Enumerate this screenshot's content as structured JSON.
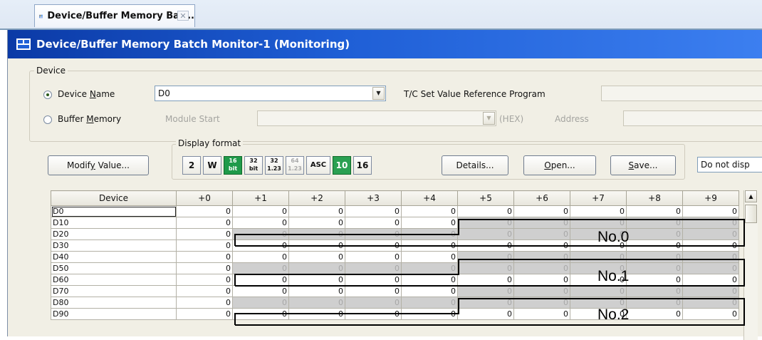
{
  "tab": {
    "title": "Device/Buffer Memory Bat...",
    "close_glyph": "✕"
  },
  "window": {
    "title": "Device/Buffer Memory Batch Monitor-1 (Monitoring)"
  },
  "device_group": {
    "title": "Device",
    "device_name_label": "Device Name",
    "device_name_value": "D0",
    "tc_label": "T/C Set Value Reference Program",
    "buffer_memory_label": "Buffer Memory",
    "module_start_label": "Module Start",
    "hex_label": "(HEX)",
    "address_label": "Address",
    "selected": "device_name"
  },
  "toolbar": {
    "modify_value_label": "Modify Value...",
    "display_format_title": "Display format",
    "formats": [
      "2",
      "W",
      "16 bit",
      "32 bit",
      "32 1.23",
      "64 1.23",
      "ASC",
      "10",
      "16"
    ],
    "details_label": "Details...",
    "open_label": "Open...",
    "save_label": "Save...",
    "display_option": "Do not disp"
  },
  "table": {
    "columns": [
      "Device",
      "+0",
      "+1",
      "+2",
      "+3",
      "+4",
      "+5",
      "+6",
      "+7",
      "+8",
      "+9"
    ],
    "rows": [
      {
        "device": "D0",
        "values": [
          "0",
          "0",
          "0",
          "0",
          "0",
          "0",
          "0",
          "0",
          "0",
          "0"
        ]
      },
      {
        "device": "D10",
        "values": [
          "0",
          "0",
          "0",
          "0",
          "0",
          "0",
          "0",
          "0",
          "0",
          "0"
        ]
      },
      {
        "device": "D20",
        "values": [
          "0",
          "0",
          "0",
          "0",
          "0",
          "0",
          "0",
          "0",
          "0",
          "0"
        ]
      },
      {
        "device": "D30",
        "values": [
          "0",
          "0",
          "0",
          "0",
          "0",
          "0",
          "0",
          "0",
          "0",
          "0"
        ]
      },
      {
        "device": "D40",
        "values": [
          "0",
          "0",
          "0",
          "0",
          "0",
          "0",
          "0",
          "0",
          "0",
          "0"
        ]
      },
      {
        "device": "D50",
        "values": [
          "0",
          "0",
          "0",
          "0",
          "0",
          "0",
          "0",
          "0",
          "0",
          "0"
        ]
      },
      {
        "device": "D60",
        "values": [
          "0",
          "0",
          "0",
          "0",
          "0",
          "0",
          "0",
          "0",
          "0",
          "0"
        ]
      },
      {
        "device": "D70",
        "values": [
          "0",
          "0",
          "0",
          "0",
          "0",
          "0",
          "0",
          "0",
          "0",
          "0"
        ]
      },
      {
        "device": "D80",
        "values": [
          "0",
          "0",
          "0",
          "0",
          "0",
          "0",
          "0",
          "0",
          "0",
          "0"
        ]
      },
      {
        "device": "D90",
        "values": [
          "0",
          "0",
          "0",
          "0",
          "0",
          "0",
          "0",
          "0",
          "0",
          "0"
        ]
      }
    ]
  },
  "callouts": [
    "No.0",
    "No.1",
    "No.2"
  ],
  "colors": {
    "titlebar": "#1f5fd6",
    "active_format": "#1f9a4a",
    "shaded_cell": "#cfcfcf"
  }
}
